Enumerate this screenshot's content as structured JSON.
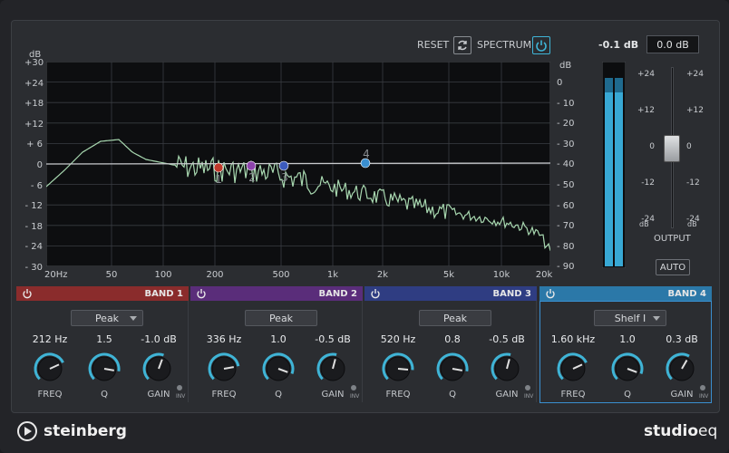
{
  "header": {
    "reset_label": "RESET",
    "spectrum_label": "SPECTRUM",
    "peak_readout": "-0.1 dB",
    "output_value": "0.0 dB"
  },
  "graph": {
    "left_unit": "dB",
    "right_unit": "dB",
    "left_ticks": [
      "+30",
      "+24",
      "+18",
      "+12",
      "+ 6",
      "0",
      "- 6",
      "- 12",
      "- 18",
      "- 24",
      "- 30"
    ],
    "right_ticks": [
      "0",
      "- 10",
      "- 20",
      "- 30",
      "- 40",
      "- 50",
      "- 60",
      "- 70",
      "- 80",
      "- 90"
    ],
    "freq_ticks": [
      "20Hz",
      "50",
      "100",
      "200",
      "500",
      "1k",
      "2k",
      "5k",
      "10k",
      "20k"
    ],
    "band_markers": [
      "1",
      "2",
      "3",
      "4"
    ]
  },
  "output": {
    "scale": [
      "+24",
      "+12",
      "0",
      "-12",
      "-24"
    ],
    "scale_bottom_unit": "dB",
    "label": "OUTPUT",
    "auto_label": "AUTO",
    "level_fraction": 0.5
  },
  "bands": [
    {
      "title": "BAND 1",
      "type": "Peak",
      "freq": "212 Hz",
      "q": "1.5",
      "gain": "-1.0 dB",
      "freq_label": "FREQ",
      "q_label": "Q",
      "gain_label": "GAIN",
      "inv_label": "INV",
      "color": "#8a2c2c"
    },
    {
      "title": "BAND 2",
      "type": "Peak",
      "freq": "336 Hz",
      "q": "1.0",
      "gain": "-0.5 dB",
      "freq_label": "FREQ",
      "q_label": "Q",
      "gain_label": "GAIN",
      "inv_label": "INV",
      "color": "#5a2d7a"
    },
    {
      "title": "BAND 3",
      "type": "Peak",
      "freq": "520 Hz",
      "q": "0.8",
      "gain": "-0.5 dB",
      "freq_label": "FREQ",
      "q_label": "Q",
      "gain_label": "GAIN",
      "inv_label": "INV",
      "color": "#2f3d82"
    },
    {
      "title": "BAND 4",
      "type": "Shelf I",
      "freq": "1.60 kHz",
      "q": "1.0",
      "gain": "0.3 dB",
      "freq_label": "FREQ",
      "q_label": "Q",
      "gain_label": "GAIN",
      "inv_label": "INV",
      "color": "#2b78a8"
    }
  ],
  "footer": {
    "brand": "steinberg",
    "product_main": "studio",
    "product_suffix": "eq"
  },
  "colors": {
    "accent": "#3fb4d6",
    "curve": "#a8d8b0",
    "band1": "#c0392b",
    "band2": "#8e44ad",
    "band3": "#3c5bbd",
    "band4": "#3a8fd0"
  }
}
